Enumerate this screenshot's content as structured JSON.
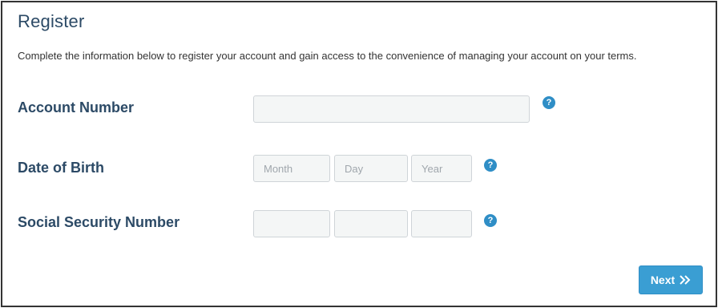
{
  "form": {
    "title": "Register",
    "description": "Complete the information below to register your account and gain access to the convenience of managing your account on your terms."
  },
  "fields": {
    "account_number": {
      "label": "Account Number",
      "value": "",
      "help_icon": "question-circle-icon"
    },
    "date_of_birth": {
      "label": "Date of Birth",
      "month_placeholder": "Month",
      "day_placeholder": "Day",
      "year_placeholder": "Year",
      "help_icon": "question-circle-icon"
    },
    "ssn": {
      "label": "Social Security Number",
      "part1_value": "",
      "part2_value": "",
      "part3_value": "",
      "help_icon": "question-circle-icon"
    }
  },
  "actions": {
    "next_label": "Next",
    "next_icon": "double-chevron-right-icon"
  },
  "colors": {
    "heading": "#2c4a66",
    "accent": "#3a9ed3",
    "help_icon": "#2f8ec6",
    "field_bg": "#f4f6f6",
    "border": "#333333"
  }
}
